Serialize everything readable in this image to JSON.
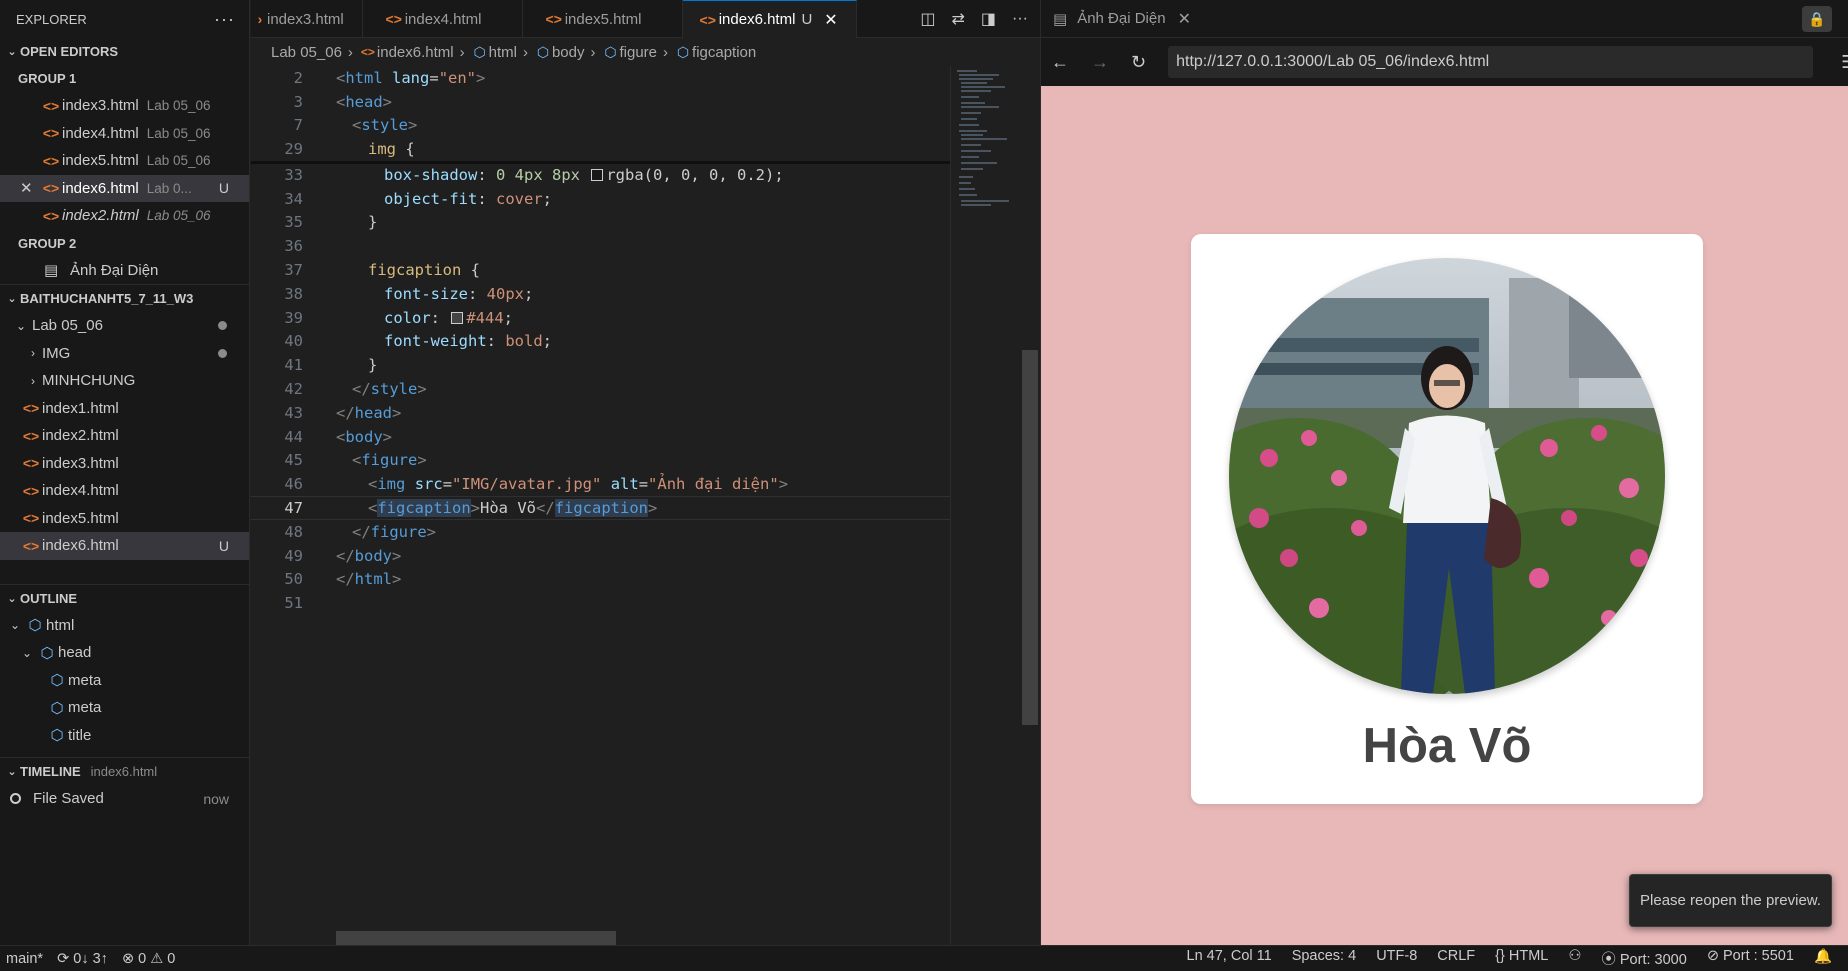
{
  "sidebar": {
    "title": "EXPLORER",
    "more": "···",
    "open_editors": {
      "title": "OPEN EDITORS",
      "group1": "GROUP 1",
      "group2": "GROUP 2",
      "files": [
        {
          "name": "index3.html",
          "desc": "Lab 05_06"
        },
        {
          "name": "index4.html",
          "desc": "Lab 05_06"
        },
        {
          "name": "index5.html",
          "desc": "Lab 05_06"
        },
        {
          "name": "index6.html",
          "desc": "Lab 0...",
          "badge": "U"
        },
        {
          "name": "index2.html",
          "desc": "Lab 05_06"
        }
      ],
      "preview": "Ảnh Đại Diện"
    },
    "folder": {
      "title": "BAITHUCHANHT5_7_11_W3",
      "items": [
        {
          "name": "Lab 05_06"
        },
        {
          "name": "IMG"
        },
        {
          "name": "MINHCHUNG"
        },
        {
          "name": "index1.html"
        },
        {
          "name": "index2.html"
        },
        {
          "name": "index3.html"
        },
        {
          "name": "index4.html"
        },
        {
          "name": "index5.html"
        },
        {
          "name": "index6.html",
          "badge": "U"
        }
      ]
    },
    "outline": {
      "title": "OUTLINE",
      "items": [
        "html",
        "head",
        "meta",
        "meta",
        "title"
      ]
    },
    "timeline": {
      "title": "TIMELINE",
      "file": "index6.html",
      "entry": "File Saved",
      "time": "now"
    }
  },
  "tabs": [
    {
      "label": "index3.html"
    },
    {
      "label": "index4.html"
    },
    {
      "label": "index5.html"
    },
    {
      "label": "index6.html",
      "badge": "U",
      "close": "✕"
    }
  ],
  "breadcrumb": [
    "Lab 05_06",
    "index6.html",
    "html",
    "body",
    "figure",
    "figcaption"
  ],
  "editor": {
    "line_numbers": [
      "2",
      "3",
      "7",
      "29",
      "33",
      "34",
      "35",
      "36",
      "37",
      "38",
      "39",
      "40",
      "41",
      "42",
      "43",
      "44",
      "45",
      "46",
      "47",
      "48",
      "49",
      "50",
      "51"
    ],
    "code": {
      "l2_tag": "html",
      "l2_attr": "lang",
      "l2_val": "\"en\"",
      "l3_tag": "head",
      "l7_tag": "style",
      "l29_sel": "img",
      "l33_prop": "box-shadow",
      "l33_num": "0 4px 8px",
      "l33_val": "rgba(0, 0, 0, 0.2)",
      "l34_prop": "object-fit",
      "l34_val": "cover",
      "l37_sel": "figcaption",
      "l38_prop": "font-size",
      "l38_val": "40px",
      "l39_prop": "color",
      "l39_val": "#444",
      "l40_prop": "font-weight",
      "l40_val": "bold",
      "l42_tag": "style",
      "l43_tag": "head",
      "l44_tag": "body",
      "l45_tag": "figure",
      "l46_tag": "img",
      "l46_attr1": "src",
      "l46_val1": "\"IMG/avatar.jpg\"",
      "l46_attr2": "alt",
      "l46_val2": "\"Ảnh đại diện\"",
      "l47_tag": "figcaption",
      "l47_text": "Hòa Võ",
      "l48_tag": "figure",
      "l49_tag": "body",
      "l50_tag": "html"
    }
  },
  "browser": {
    "tab_title": "Ảnh Đại Diện",
    "url": "http://127.0.0.1:3000/Lab 05_06/index6.html",
    "caption": "Hòa Võ",
    "toast": "Please reopen the preview."
  },
  "status": {
    "branch": "main*",
    "sync": "0↓ 3↑",
    "errors": "0",
    "warnings": "0",
    "position": "Ln 47, Col 11",
    "spaces": "Spaces: 4",
    "encoding": "UTF-8",
    "eol": "CRLF",
    "language": "HTML",
    "port1": "Port: 3000",
    "port2": "Port : 5501"
  },
  "colors": {
    "accent": "#0078d4",
    "preview_bg": "#e8b8b8",
    "caption_color": "#444444"
  }
}
